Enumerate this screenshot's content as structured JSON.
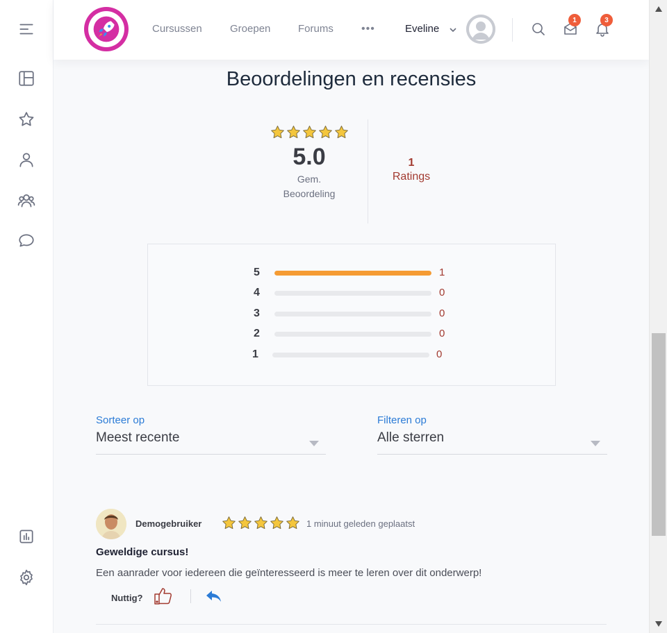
{
  "sidebar": {
    "items": [
      {
        "icon": "menu-icon"
      },
      {
        "icon": "dashboard-icon"
      },
      {
        "icon": "star-icon"
      },
      {
        "icon": "user-icon"
      },
      {
        "icon": "groups-icon"
      },
      {
        "icon": "forum-chat-icon"
      },
      {
        "icon": "analytics-icon"
      },
      {
        "icon": "gear-icon"
      }
    ]
  },
  "header": {
    "logo_icon": "rocket-icon",
    "nav": [
      "Cursussen",
      "Groepen",
      "Forums"
    ],
    "more_label": "•••",
    "user_name": "Eveline",
    "messages_badge": "1",
    "notifications_badge": "3",
    "colors": {
      "logo": "#d42ea3",
      "badge": "#ef5d3a"
    }
  },
  "page": {
    "title": "Beoordelingen en recensies"
  },
  "summary": {
    "average": "5.0",
    "average_label_line1": "Gem.",
    "average_label_line2": "Beoordeling",
    "ratings_count": "1",
    "ratings_label": "Ratings",
    "stars_filled": 5
  },
  "breakdown": {
    "rows": [
      {
        "stars": "5",
        "count": "1",
        "fraction": 1.0
      },
      {
        "stars": "4",
        "count": "0",
        "fraction": 0
      },
      {
        "stars": "3",
        "count": "0",
        "fraction": 0
      },
      {
        "stars": "2",
        "count": "0",
        "fraction": 0
      },
      {
        "stars": "1",
        "count": "0",
        "fraction": 0
      }
    ],
    "colors": {
      "fill": "#f59b33",
      "count": "#a23a30"
    }
  },
  "filters": {
    "sort": {
      "label": "Sorteer op",
      "value": "Meest recente"
    },
    "filter": {
      "label": "Filteren op",
      "value": "Alle sterren"
    }
  },
  "review": {
    "author": "Demogebruiker",
    "stars": 5,
    "time": "1 minuut geleden geplaatst",
    "title": "Geweldige cursus!",
    "text": "Een aanrader voor iedereen die geïnteresseerd is meer te leren over dit onderwerp!",
    "helpful_label": "Nuttig?"
  }
}
